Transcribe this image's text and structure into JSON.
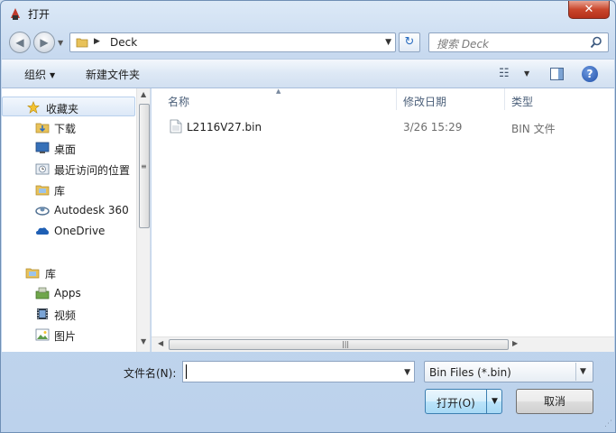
{
  "window": {
    "title": "打开",
    "close_label": "✕"
  },
  "address": {
    "path_label": "Deck",
    "search_placeholder": "搜索 Deck"
  },
  "toolbar": {
    "organize_label": "组织",
    "new_folder_label": "新建文件夹",
    "help_label": "?"
  },
  "nav": {
    "items": [
      {
        "label": "收藏夹",
        "icon": "star-icon"
      },
      {
        "label": "下载",
        "icon": "download-folder-icon"
      },
      {
        "label": "桌面",
        "icon": "desktop-icon"
      },
      {
        "label": "最近访问的位置",
        "icon": "recent-places-icon"
      },
      {
        "label": "库",
        "icon": "library-icon"
      },
      {
        "label": "Autodesk 360",
        "icon": "autodesk-icon"
      },
      {
        "label": "OneDrive",
        "icon": "onedrive-icon"
      },
      {
        "label": "库",
        "icon": "library-icon"
      },
      {
        "label": "Apps",
        "icon": "apps-icon"
      },
      {
        "label": "视频",
        "icon": "video-icon"
      },
      {
        "label": "图片",
        "icon": "picture-icon"
      }
    ]
  },
  "file_list": {
    "columns": [
      "名称",
      "修改日期",
      "类型"
    ],
    "rows": [
      {
        "name": "L2116V27.bin",
        "date": "3/26 15:29",
        "type": "BIN 文件"
      }
    ]
  },
  "bottom": {
    "filename_label": "文件名(N):",
    "filename_value": "",
    "filter_label": "Bin Files (*.bin)",
    "open_label": "打开(O)",
    "cancel_label": "取消"
  },
  "colors": {
    "accent": "#3c7fb1",
    "selection": "#dce8f7",
    "close": "#c9462c"
  }
}
